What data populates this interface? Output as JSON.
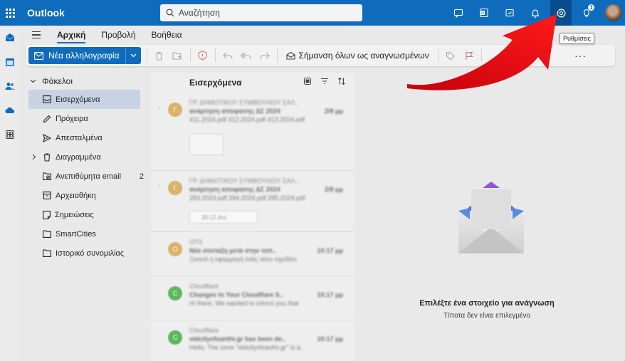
{
  "app": {
    "title": "Outlook"
  },
  "search": {
    "placeholder": "Αναζήτηση"
  },
  "topbar": {
    "icons": [
      "meet-now-icon",
      "onenote-icon",
      "my-day-icon",
      "bell-icon",
      "settings-icon",
      "tips-icon"
    ],
    "tips_badge": "1"
  },
  "tooltip": {
    "text": "Ρυθμίσεις"
  },
  "ribbon": {
    "tabs": [
      "Αρχική",
      "Προβολή",
      "Βοήθεια"
    ],
    "active_tab": "Αρχική",
    "new_mail_label": "Νέα αλληλογραφία",
    "mark_all_read_label": "Σήμανση όλων ως αναγνωσμένων",
    "more_label": "···"
  },
  "folders": {
    "header": "Φάκελοι",
    "items": [
      {
        "label": "Εισερχόμενα",
        "icon": "inbox-icon",
        "active": true,
        "count": ""
      },
      {
        "label": "Πρόχειρα",
        "icon": "pencil-icon",
        "count": ""
      },
      {
        "label": "Απεσταλμένα",
        "icon": "send-icon",
        "count": ""
      },
      {
        "label": "Διαγραμμένα",
        "icon": "trash-icon",
        "count": ""
      },
      {
        "label": "Ανεπιθύμητα email",
        "icon": "junk-icon",
        "count": "2"
      },
      {
        "label": "Αρχειοθήκη",
        "icon": "archive-icon",
        "count": ""
      },
      {
        "label": "Σημειώσεις",
        "icon": "note-icon",
        "count": ""
      },
      {
        "label": "SmartCities",
        "icon": "folder-icon",
        "count": ""
      },
      {
        "label": "Ιστορικό συνομιλίας",
        "icon": "folder-icon",
        "count": ""
      }
    ]
  },
  "message_list": {
    "title": "Εισερχόμενα",
    "messages": [
      {
        "avatar": "Γ",
        "color": "#d9b36a",
        "sender": "ΓΡ. ΔΗΜΟΤΙΚΟΥ ΣΥΜΒΟΥΛΙΟΥ ΣΑΛ..",
        "subject": "ανάρτηση αποφασης ΔΣ 2024",
        "time": "2/8 μμ",
        "preview": "411.2024.pdf 412.2024.pdf 413.2024.pdf",
        "kind": "thumb"
      },
      {
        "avatar": "Γ",
        "color": "#d9b36a",
        "sender": "ΓΡ. ΔΗΜΟΤΙΚΟΥ ΣΥΜΒΟΥΛΙΟΥ ΣΑΛ..",
        "subject": "ανάρτηση αποφασης ΔΣ 2024",
        "time": "2/8 μμ",
        "preview": "283.2024.pdf 284.2024.pdf 285.2024.pdf",
        "kind": "attach",
        "attach": "30-12.doc"
      },
      {
        "avatar": "O",
        "color": "#d9b36a",
        "sender": "OTS",
        "subject": "Νέα σύνταξη μετά στην τοπ..",
        "time": "10:17 μμ",
        "preview": "Ξεκινά η εφαρμογή ενός νέου σχεδίου",
        "kind": ""
      },
      {
        "avatar": "C",
        "color": "#5cb85c",
        "sender": "Cloudflare",
        "subject": "Changes to Your Cloudflare S..",
        "time": "10:17 μμ",
        "preview": "Hi there, We wanted to inform you that",
        "kind": ""
      },
      {
        "avatar": "C",
        "color": "#5cb85c",
        "sender": "Cloudflare",
        "subject": "oldcityofxanthi.gr has been de..",
        "time": "10:17 μμ",
        "preview": "Hello, The zone \"oldcityofxanthi.gr\" is a..",
        "kind": ""
      }
    ]
  },
  "reading_pane": {
    "title": "Επιλέξτε ένα στοιχείο για ανάγνωση",
    "subtitle": "Τίποτα δεν είναι επιλεγμένο"
  },
  "colors": {
    "brand": "#0f6cbd",
    "arrow": "#e3000f"
  }
}
